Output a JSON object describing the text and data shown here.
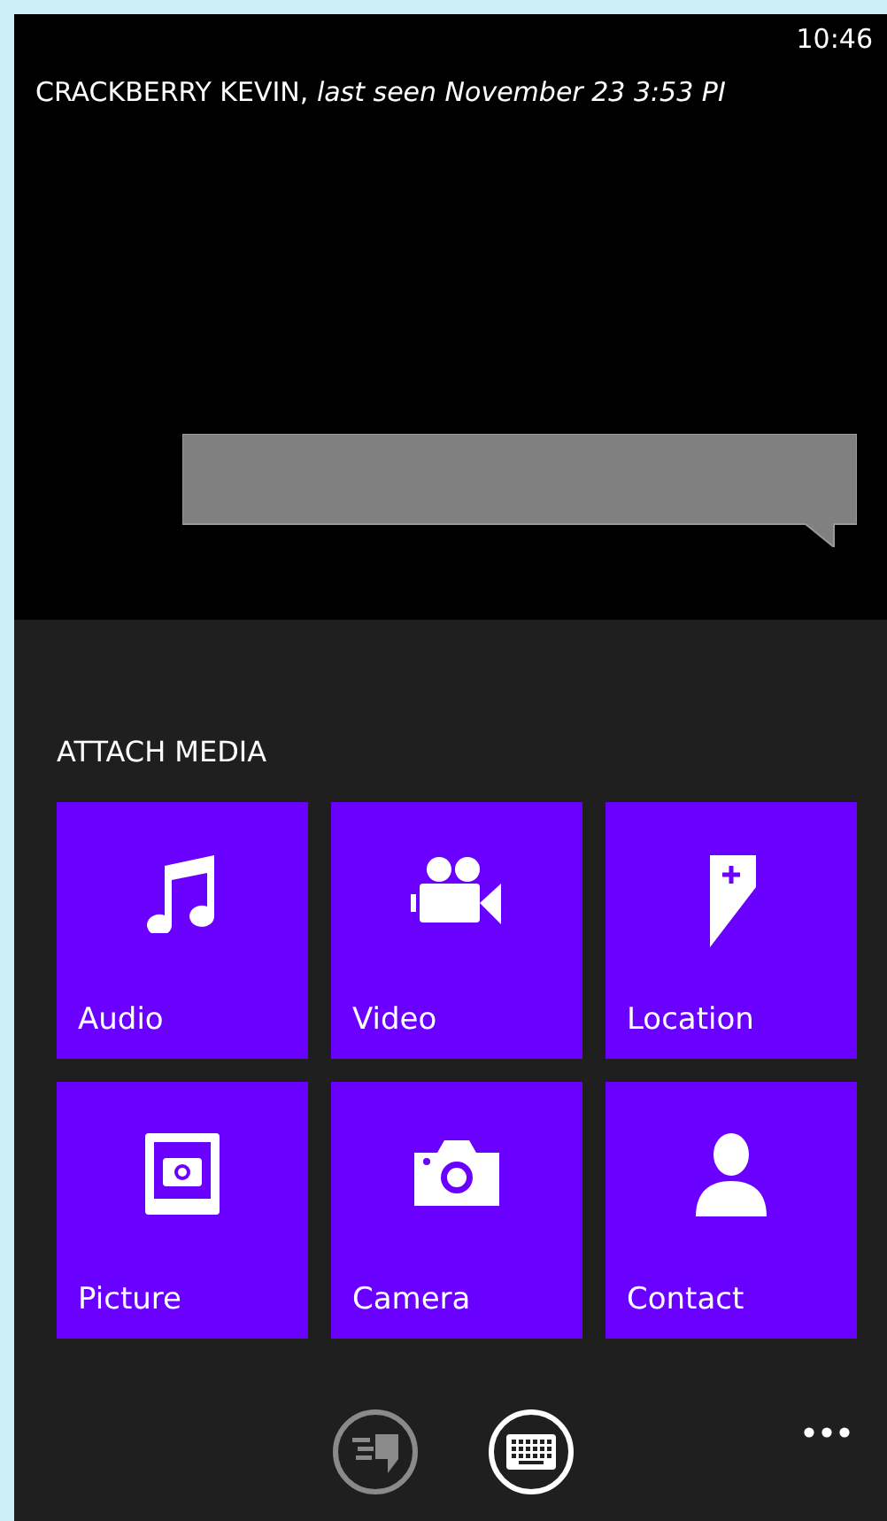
{
  "status_bar": {
    "time": "10:46"
  },
  "header": {
    "title": "CRACKBERRY KEVIN, *last seen November 23 3:53 PI*"
  },
  "attach": {
    "heading": "ATTACH MEDIA",
    "tiles": [
      {
        "label": "Audio",
        "kind": "audio"
      },
      {
        "label": "Video",
        "kind": "video"
      },
      {
        "label": "Location",
        "kind": "location"
      },
      {
        "label": "Picture",
        "kind": "picture"
      },
      {
        "label": "Camera",
        "kind": "camera"
      },
      {
        "label": "Contact",
        "kind": "contact"
      }
    ]
  },
  "app_bar": {
    "buttons": [
      {
        "kind": "send",
        "disabled": true
      },
      {
        "kind": "keyboard",
        "disabled": false
      }
    ]
  }
}
